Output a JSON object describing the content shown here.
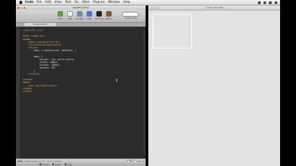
{
  "menubar": {
    "items": [
      "Coda",
      "File",
      "Edit",
      "View",
      "Text",
      "Go",
      "Sites",
      "Plug-ins",
      "Window",
      "Help"
    ]
  },
  "coda": {
    "window_title": "borders.html",
    "toolbar": [
      {
        "label": "Sites",
        "icon": "sites-icon"
      },
      {
        "label": "Edit",
        "icon": "edit-icon"
      },
      {
        "label": "Preview",
        "icon": "preview-icon"
      },
      {
        "label": "CSS",
        "icon": "css-icon"
      },
      {
        "label": "Terminal",
        "icon": "terminal-icon"
      },
      {
        "label": "Books",
        "icon": "books-icon"
      }
    ],
    "search_label": "Search Files",
    "tab_label": "borders.html",
    "code_lines": [
      "<!DOCTYPE html>",
      "",
      "<html lang=\"en\">",
      "<head>",
      "    <meta charset=\"utf-8\">",
      "    <title>untitled</title>",
      "    <style>",
      "        body { background: #d2d2d2; }",
      "",
      "        #box {",
      "            border: 1px solid white;",
      "            width: 200px;",
      "            height: 100px;",
      "            margin: 50;",
      "        }",
      "    </style>",
      "",
      "</head>",
      "<body>",
      "    <div id=\"box\"></div>",
      "</body>",
      "</html>"
    ],
    "status": {
      "language": "style",
      "path": "<style>body | color : red; }</style>",
      "more_button": "More",
      "position": "14 : 1"
    },
    "bottom_bar": [
      "Home",
      "Hints",
      "Clips"
    ]
  },
  "preview": {
    "window_title": "Lively Preview"
  }
}
